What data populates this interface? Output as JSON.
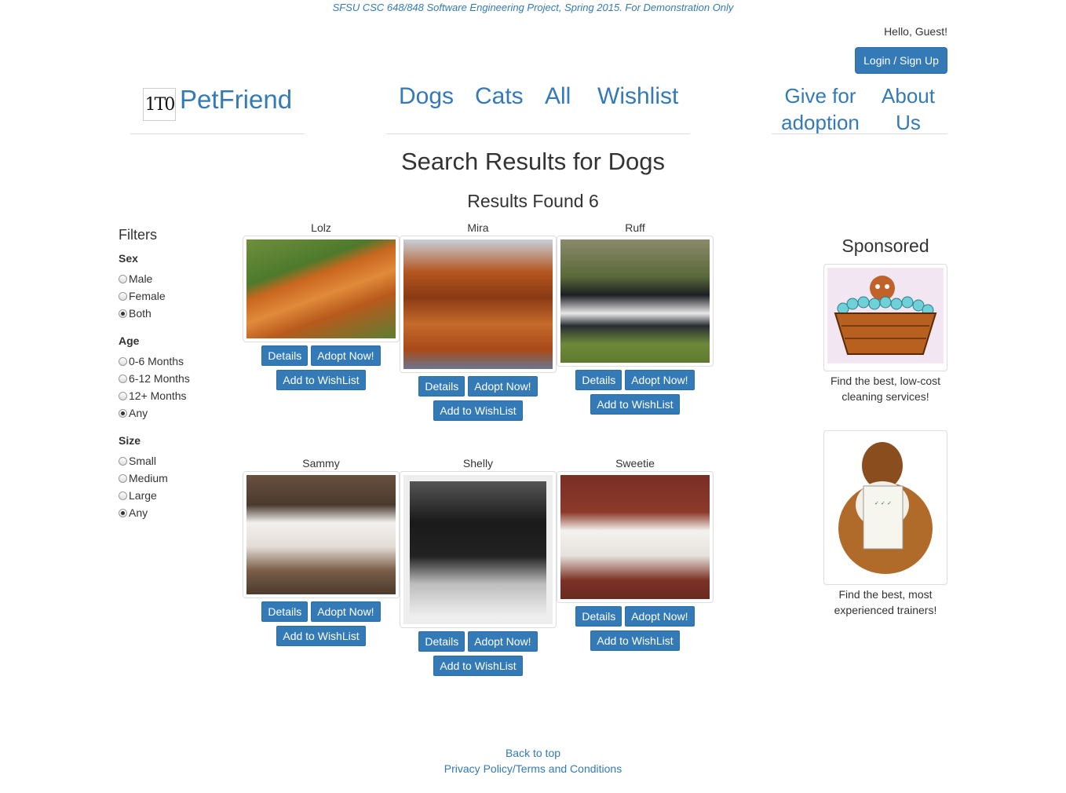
{
  "banner": "SFSU CSC 648/848 Software Engineering Project, Spring 2015. For Demonstration Only",
  "header": {
    "greeting": "Hello, Guest!",
    "login_label": "Login / Sign Up",
    "logo_text": "1T0",
    "brand": "PetFriend",
    "nav": [
      "Dogs",
      "Cats",
      "All",
      "Wishlist"
    ],
    "nav_right": [
      {
        "line1": "Give for",
        "line2": "adoption"
      },
      {
        "line1": "About",
        "line2": "Us"
      }
    ]
  },
  "main": {
    "title": "Search Results for Dogs",
    "results": "Results Found 6"
  },
  "filters": {
    "title": "Filters",
    "sex": {
      "label": "Sex",
      "options": [
        "Male",
        "Female",
        "Both"
      ],
      "selected": "Both"
    },
    "age": {
      "label": "Age",
      "options": [
        "0-6 Months",
        "6-12 Months",
        "12+ Months",
        "Any"
      ],
      "selected": "Any"
    },
    "size": {
      "label": "Size",
      "options": [
        "Small",
        "Medium",
        "Large",
        "Any"
      ],
      "selected": "Any"
    }
  },
  "pets": [
    {
      "name": "Lolz",
      "icon": "pomeranian-photo"
    },
    {
      "name": "Mira",
      "icon": "cavalier-photo"
    },
    {
      "name": "Ruff",
      "icon": "husky-photo"
    },
    {
      "name": "Sammy",
      "icon": "puppy-photo"
    },
    {
      "name": "Shelly",
      "icon": "black-dog-photo"
    },
    {
      "name": "Sweetie",
      "icon": "fluffy-dog-photo"
    }
  ],
  "buttons": {
    "details": "Details",
    "adopt": "Adopt Now!",
    "wishlist": "Add to WishList"
  },
  "sponsored": {
    "title": "Sponsored",
    "ads": [
      {
        "caption1": "Find the best, low-cost",
        "caption2": "cleaning services!",
        "icon": "dog-bath-illustration"
      },
      {
        "caption1": "Find the best, most",
        "caption2": "experienced trainers!",
        "icon": "sheltie-trainer-photo"
      }
    ]
  },
  "footer": {
    "back_to_top": "Back to top",
    "privacy": "Privacy Policy/Terms and Conditions"
  },
  "colors": {
    "accent": "#337ab7",
    "text": "#333333"
  }
}
